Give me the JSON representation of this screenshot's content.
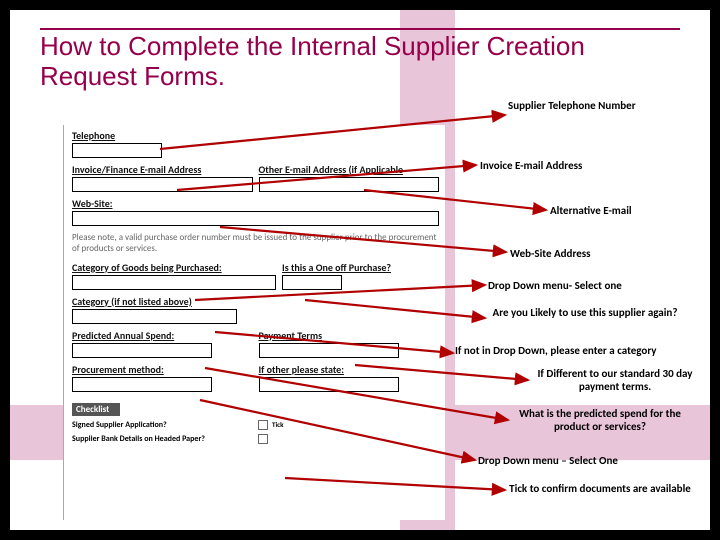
{
  "title": "How to Complete the Internal Supplier Creation Request Forms.",
  "form": {
    "telephone_label": "Telephone",
    "invoice_email_label": "Invoice/Finance E-mail Address",
    "other_email_label": "Other E-mail Address (if Applicable",
    "website_label": "Web-Site:",
    "note_text": "Please note, a valid purchase order number must be issued to the supplier prior to the procurement of products or services.",
    "category_label": "Category of Goods being Purchased:",
    "oneoff_label": "Is this a One off Purchase?",
    "category_other_label": "Category (if not listed above)",
    "predicted_spend_label": "Predicted Annual Spend:",
    "payment_terms_label": "Payment Terms",
    "procurement_label": "Procurement method:",
    "if_other_label": "If other please state:",
    "checklist_header": "Checklist",
    "chk1": "Signed Supplier Application?",
    "chk2": "Supplier Bank Details on Headed Paper?",
    "tick": "Tick"
  },
  "annotations": {
    "tel": "Supplier Telephone Number",
    "invoice": "Invoice E-mail Address",
    "alt": "Alternative E-mail",
    "web": "Web-Site Address",
    "dd1": "Drop Down menu- Select one",
    "likely": "Are you Likely to use this supplier again?",
    "notdd": "If not in Drop Down, please enter a category",
    "diff": "If Different to our standard 30 day payment terms.",
    "predicted": "What is the predicted spend for the product or services?",
    "dd2": "Drop Down menu – Select One",
    "tick_confirm": "Tick to confirm documents are available"
  }
}
